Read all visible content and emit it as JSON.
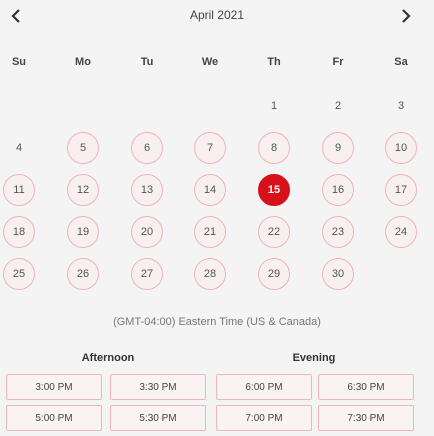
{
  "header": {
    "month_title": "April 2021"
  },
  "weekdays": [
    "Su",
    "Mo",
    "Tu",
    "We",
    "Th",
    "Fr",
    "Sa"
  ],
  "days": [
    {
      "label": "1",
      "state": "plain"
    },
    {
      "label": "2",
      "state": "plain"
    },
    {
      "label": "3",
      "state": "plain"
    },
    {
      "label": "4",
      "state": "plain"
    },
    {
      "label": "5",
      "state": "available"
    },
    {
      "label": "6",
      "state": "available"
    },
    {
      "label": "7",
      "state": "available"
    },
    {
      "label": "8",
      "state": "available"
    },
    {
      "label": "9",
      "state": "available"
    },
    {
      "label": "10",
      "state": "available"
    },
    {
      "label": "11",
      "state": "available"
    },
    {
      "label": "12",
      "state": "available"
    },
    {
      "label": "13",
      "state": "available"
    },
    {
      "label": "14",
      "state": "available"
    },
    {
      "label": "15",
      "state": "selected"
    },
    {
      "label": "16",
      "state": "available"
    },
    {
      "label": "17",
      "state": "available"
    },
    {
      "label": "18",
      "state": "available"
    },
    {
      "label": "19",
      "state": "available"
    },
    {
      "label": "20",
      "state": "available"
    },
    {
      "label": "21",
      "state": "available"
    },
    {
      "label": "22",
      "state": "available"
    },
    {
      "label": "23",
      "state": "available"
    },
    {
      "label": "24",
      "state": "available"
    },
    {
      "label": "25",
      "state": "available"
    },
    {
      "label": "26",
      "state": "available"
    },
    {
      "label": "27",
      "state": "available"
    },
    {
      "label": "28",
      "state": "available"
    },
    {
      "label": "29",
      "state": "available"
    },
    {
      "label": "30",
      "state": "available"
    }
  ],
  "timezone": "(GMT-04:00) Eastern Time (US & Canada)",
  "sections": {
    "afternoon_label": "Afternoon",
    "evening_label": "Evening"
  },
  "slots": {
    "afternoon": [
      "3:00 PM",
      "3:30 PM",
      "5:00 PM",
      "5:30 PM"
    ],
    "evening": [
      "6:00 PM",
      "6:30 PM",
      "7:00 PM",
      "7:30 PM"
    ]
  },
  "colors": {
    "selected": "#d8101c",
    "available_border": "#f0b4b4"
  }
}
